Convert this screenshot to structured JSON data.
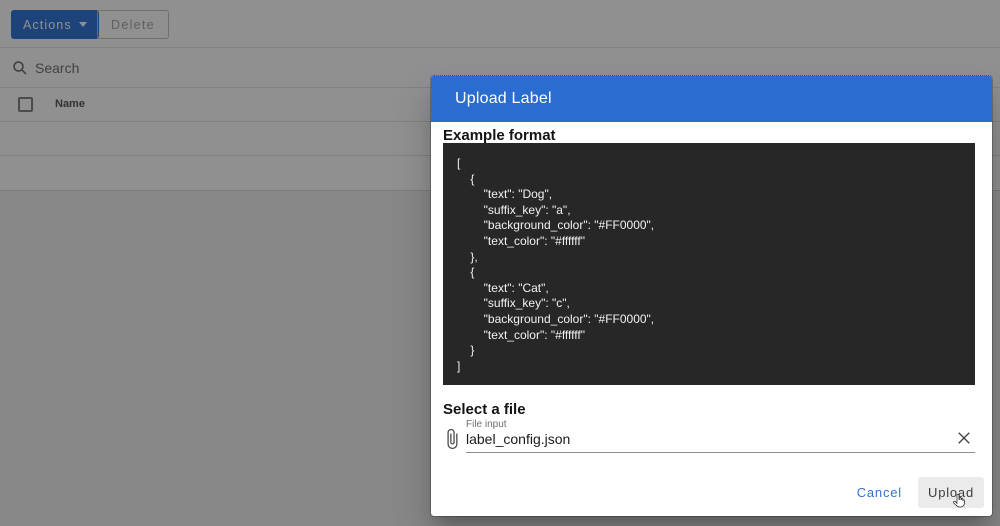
{
  "background": {
    "toolbar": {
      "actions_label": "Actions",
      "delete_label": "Delete"
    },
    "search": {
      "placeholder": "Search"
    },
    "table": {
      "name_column": "Name"
    }
  },
  "modal": {
    "title": "Upload Label",
    "example": {
      "heading": "Example format",
      "code": "[\n    {\n        \"text\": \"Dog\",\n        \"suffix_key\": \"a\",\n        \"background_color\": \"#FF0000\",\n        \"text_color\": \"#ffffff\"\n    },\n    {\n        \"text\": \"Cat\",\n        \"suffix_key\": \"c\",\n        \"background_color\": \"#FF0000\",\n        \"text_color\": \"#ffffff\"\n    }\n]"
    },
    "file": {
      "heading": "Select a file",
      "input_label": "File input",
      "value": "label_config.json"
    },
    "actions": {
      "cancel": "Cancel",
      "upload": "Upload"
    }
  },
  "colors": {
    "primary_header": "#2a6cd0",
    "toolbar_button": "#1967d2",
    "code_background": "#272727",
    "cancel_text": "#3471d6"
  }
}
